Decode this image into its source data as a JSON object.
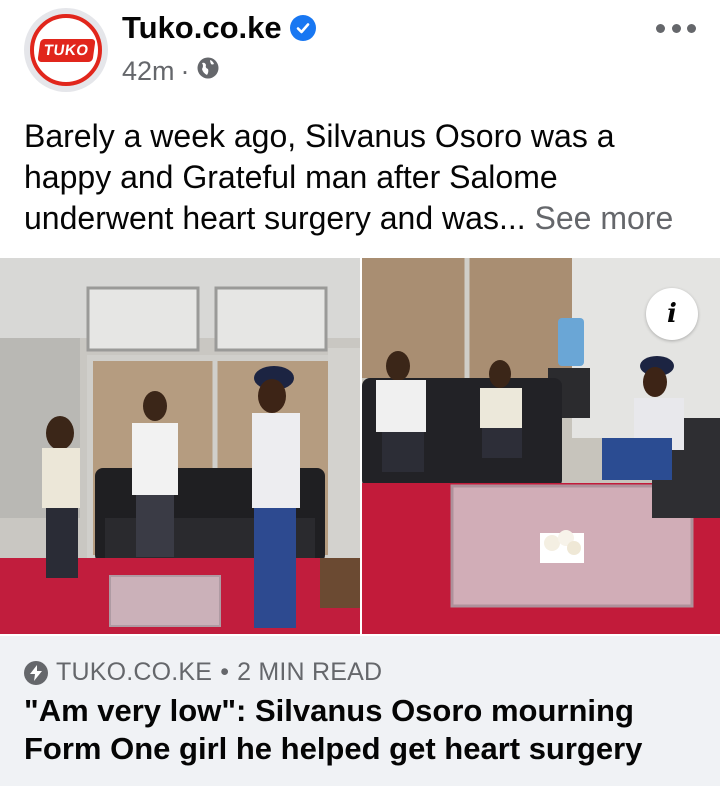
{
  "post": {
    "page_name": "Tuko.co.ke",
    "avatar_text": "TUKO",
    "time": "42m",
    "separator": "·",
    "audience_icon": "globe-icon",
    "verified_icon": "verified-badge-icon",
    "text": "Barely a week ago, Silvanus Osoro was a happy and Grateful man after Salome underwent heart surgery and was...",
    "see_more": "See more"
  },
  "photos": {
    "info_button": "i"
  },
  "link_card": {
    "source": "TUKO.CO.KE",
    "dot": "•",
    "read_time": "2 MIN READ",
    "headline": "\"Am very low\": Silvanus Osoro mourning Form One girl he helped get heart surgery"
  },
  "colors": {
    "brand_red": "#e1261c",
    "verified_blue": "#1877f2",
    "secondary_text": "#65676b",
    "card_bg": "#f0f2f5"
  }
}
